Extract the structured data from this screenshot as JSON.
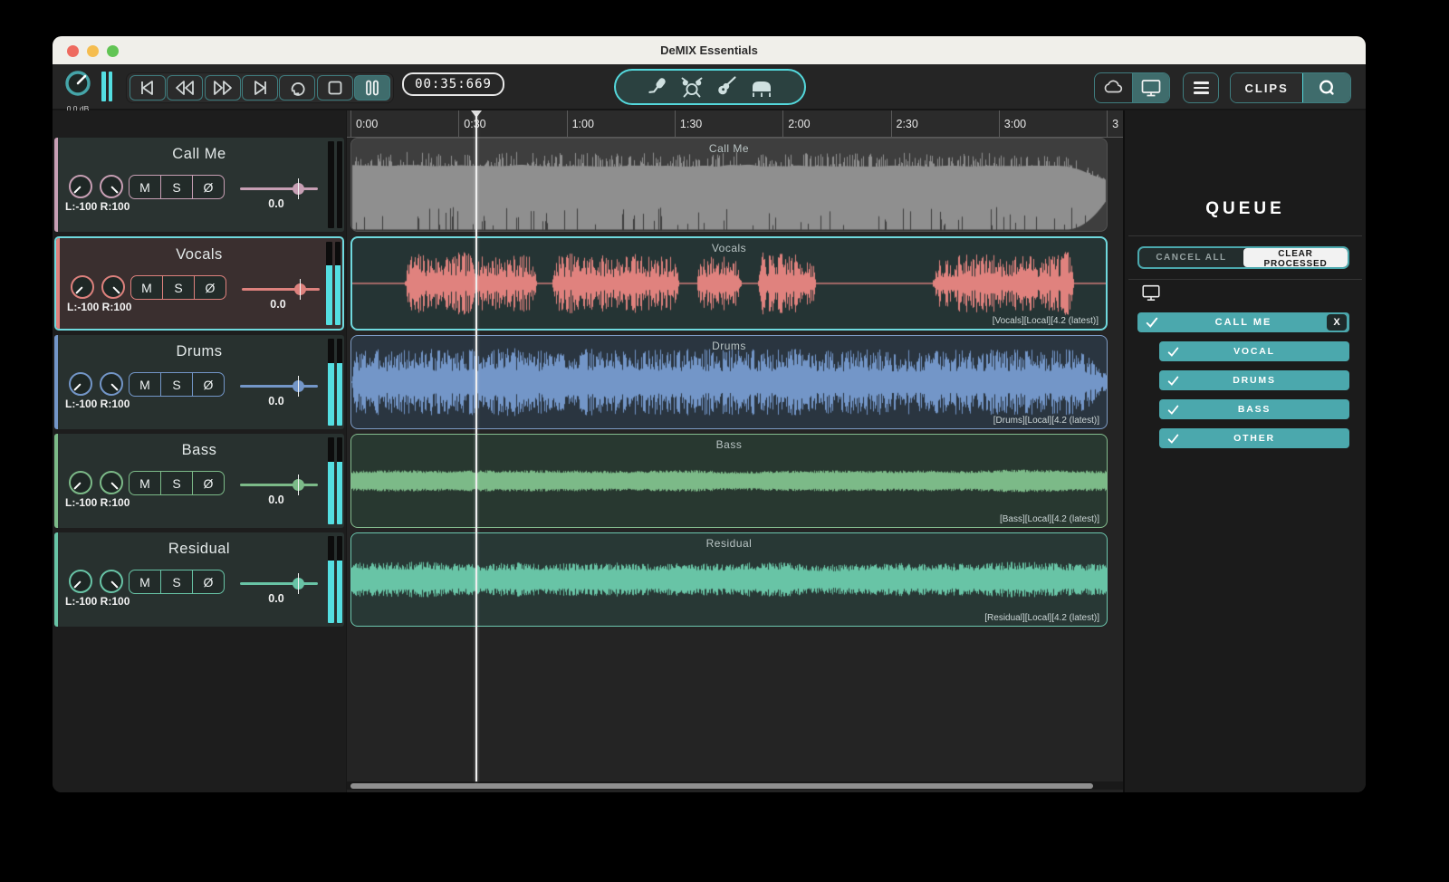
{
  "window": {
    "title": "DeMIX Essentials"
  },
  "toolbar": {
    "master_volume_label": "0.0 dB",
    "time_display": "00:35:669",
    "clips_button": "CLIPS",
    "transport_buttons": [
      "skip-to-start",
      "rewind",
      "fast-forward",
      "skip-to-end",
      "loop",
      "stop",
      "pause"
    ],
    "active_transport": "pause",
    "stem_icons": [
      "microphone",
      "drum-kit",
      "guitar",
      "grand-piano"
    ],
    "source_toggle": {
      "options": [
        "cloud",
        "computer"
      ],
      "active": "computer"
    }
  },
  "timeline": {
    "ruler_ticks": [
      "0:00",
      "0:30",
      "1:00",
      "1:30",
      "2:00",
      "2:30",
      "3:00",
      "3"
    ],
    "playhead_position": "0:35"
  },
  "tracks": [
    {
      "name": "Call Me",
      "color": "#c79fb4",
      "bg": "#2a3331",
      "clip_bg": "#3e3e3e",
      "clip_border": "",
      "wave": "#8f8f8f",
      "wave_style": "full",
      "mute": "M",
      "solo": "S",
      "phase": "Ø",
      "gain": "0.0",
      "pan_range": "L:-100 R:100",
      "selected": false,
      "meter_on": false,
      "tag": ""
    },
    {
      "name": "Vocals",
      "color": "#dd817d",
      "bg": "#3a2f2f",
      "clip_bg": "#253434",
      "clip_border": "#6fd9de",
      "wave": "#e0827e",
      "wave_style": "bursts",
      "mute": "M",
      "solo": "S",
      "phase": "Ø",
      "gain": "0.0",
      "pan_range": "L:-100 R:100",
      "selected": true,
      "meter_on": true,
      "tag": "[Vocals][Local][4.2 (latest)]"
    },
    {
      "name": "Drums",
      "color": "#7396c8",
      "bg": "#28312f",
      "clip_bg": "#2a3540",
      "clip_border": "#7d9cc6",
      "wave": "#7396c8",
      "wave_style": "dense",
      "mute": "M",
      "solo": "S",
      "phase": "Ø",
      "gain": "0.0",
      "pan_range": "L:-100 R:100",
      "selected": false,
      "meter_on": true,
      "tag": "[Drums][Local][4.2 (latest)]"
    },
    {
      "name": "Bass",
      "color": "#7cba88",
      "bg": "#28312f",
      "clip_bg": "#283830",
      "clip_border": "#84bd8f",
      "wave": "#7cba88",
      "wave_style": "medium",
      "mute": "M",
      "solo": "S",
      "phase": "Ø",
      "gain": "0.0",
      "pan_range": "L:-100 R:100",
      "selected": false,
      "meter_on": true,
      "tag": "[Bass][Local][4.2 (latest)]"
    },
    {
      "name": "Residual",
      "color": "#68c4a6",
      "bg": "#28312f",
      "clip_bg": "#283835",
      "clip_border": "#6cc7ae",
      "wave": "#68c4a6",
      "wave_style": "lumpy",
      "mute": "M",
      "solo": "S",
      "phase": "Ø",
      "gain": "0.0",
      "pan_range": "L:-100 R:100",
      "selected": false,
      "meter_on": true,
      "tag": "[Residual][Local][4.2 (latest)]"
    }
  ],
  "queue": {
    "title": "QUEUE",
    "cancel_all": "CANCEL ALL",
    "clear_processed": "CLEAR PROCESSED",
    "accent": "#4ba8ad",
    "jobs": [
      {
        "name": "CALL ME",
        "close": "X",
        "stems": [
          "VOCAL",
          "DRUMS",
          "BASS",
          "OTHER"
        ]
      }
    ]
  }
}
